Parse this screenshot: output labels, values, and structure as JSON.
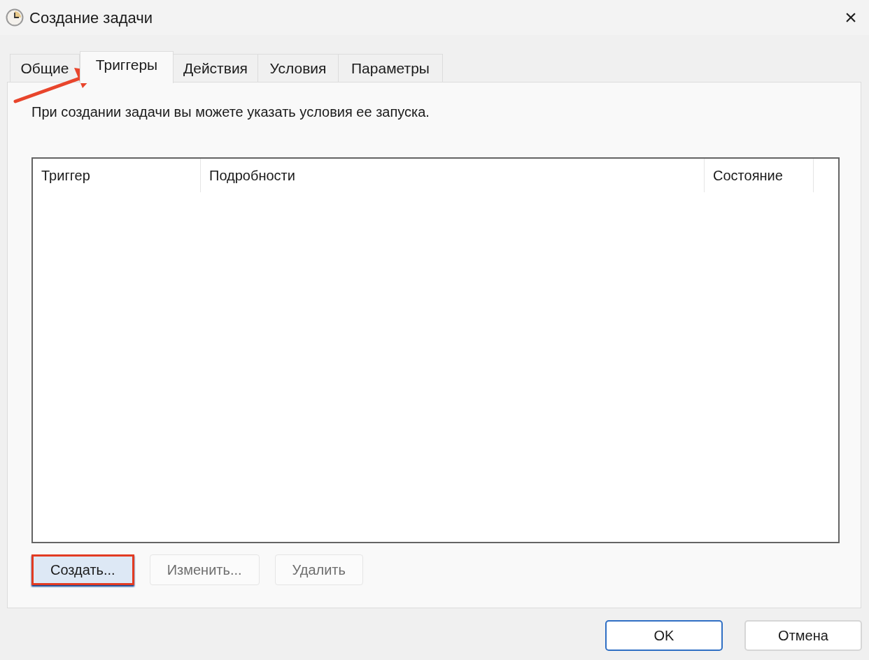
{
  "window": {
    "title": "Создание задачи",
    "close": "×"
  },
  "tabs": [
    {
      "label": "Общие",
      "selected": false
    },
    {
      "label": "Триггеры",
      "selected": true
    },
    {
      "label": "Действия",
      "selected": false
    },
    {
      "label": "Условия",
      "selected": false
    },
    {
      "label": "Параметры",
      "selected": false
    }
  ],
  "description": "При создании задачи вы можете указать условия ее запуска.",
  "table": {
    "columns": [
      "Триггер",
      "Подробности",
      "Состояние"
    ]
  },
  "list_buttons": [
    {
      "label": "Создать...",
      "disabled": false,
      "highlighted": true
    },
    {
      "label": "Изменить...",
      "disabled": true,
      "highlighted": false
    },
    {
      "label": "Удалить",
      "disabled": true,
      "highlighted": false
    }
  ],
  "dialog_buttons": [
    {
      "label": "OK",
      "default": true
    },
    {
      "label": "Отмена",
      "default": false
    }
  ]
}
